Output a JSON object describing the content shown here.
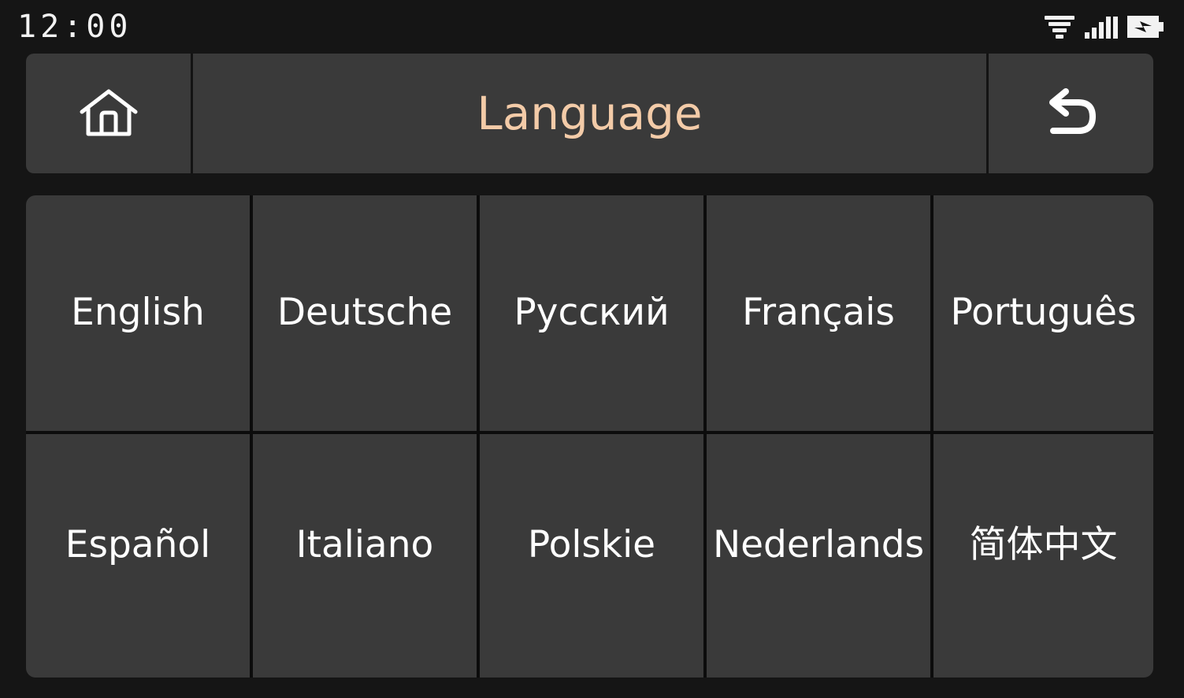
{
  "status_bar": {
    "clock": "12:00",
    "icons": [
      {
        "name": "wifi-icon",
        "label": "wifi"
      },
      {
        "name": "cellular-signal-icon",
        "label": "signal"
      },
      {
        "name": "battery-charging-icon",
        "label": "battery charging"
      }
    ]
  },
  "header": {
    "home_label": "Home",
    "title": "Language",
    "back_label": "Back"
  },
  "colors": {
    "page_background": "#151515",
    "tile_background": "#3a3a3a",
    "separator": "#0c0c0c",
    "title_accent": "#f3cba8",
    "label_text": "#ffffff",
    "icon_color": "#ffffff"
  },
  "languages": {
    "row1": [
      {
        "label": "English",
        "code": "en"
      },
      {
        "label": "Deutsche",
        "code": "de"
      },
      {
        "label": "Русский",
        "code": "ru"
      },
      {
        "label": "Français",
        "code": "fr"
      },
      {
        "label": "Português",
        "code": "pt"
      }
    ],
    "row2": [
      {
        "label": "Español",
        "code": "es"
      },
      {
        "label": "Italiano",
        "code": "it"
      },
      {
        "label": "Polskie",
        "code": "pl"
      },
      {
        "label": "Nederlands",
        "code": "nl"
      },
      {
        "label": "简体中文",
        "code": "zh-CN"
      }
    ]
  }
}
